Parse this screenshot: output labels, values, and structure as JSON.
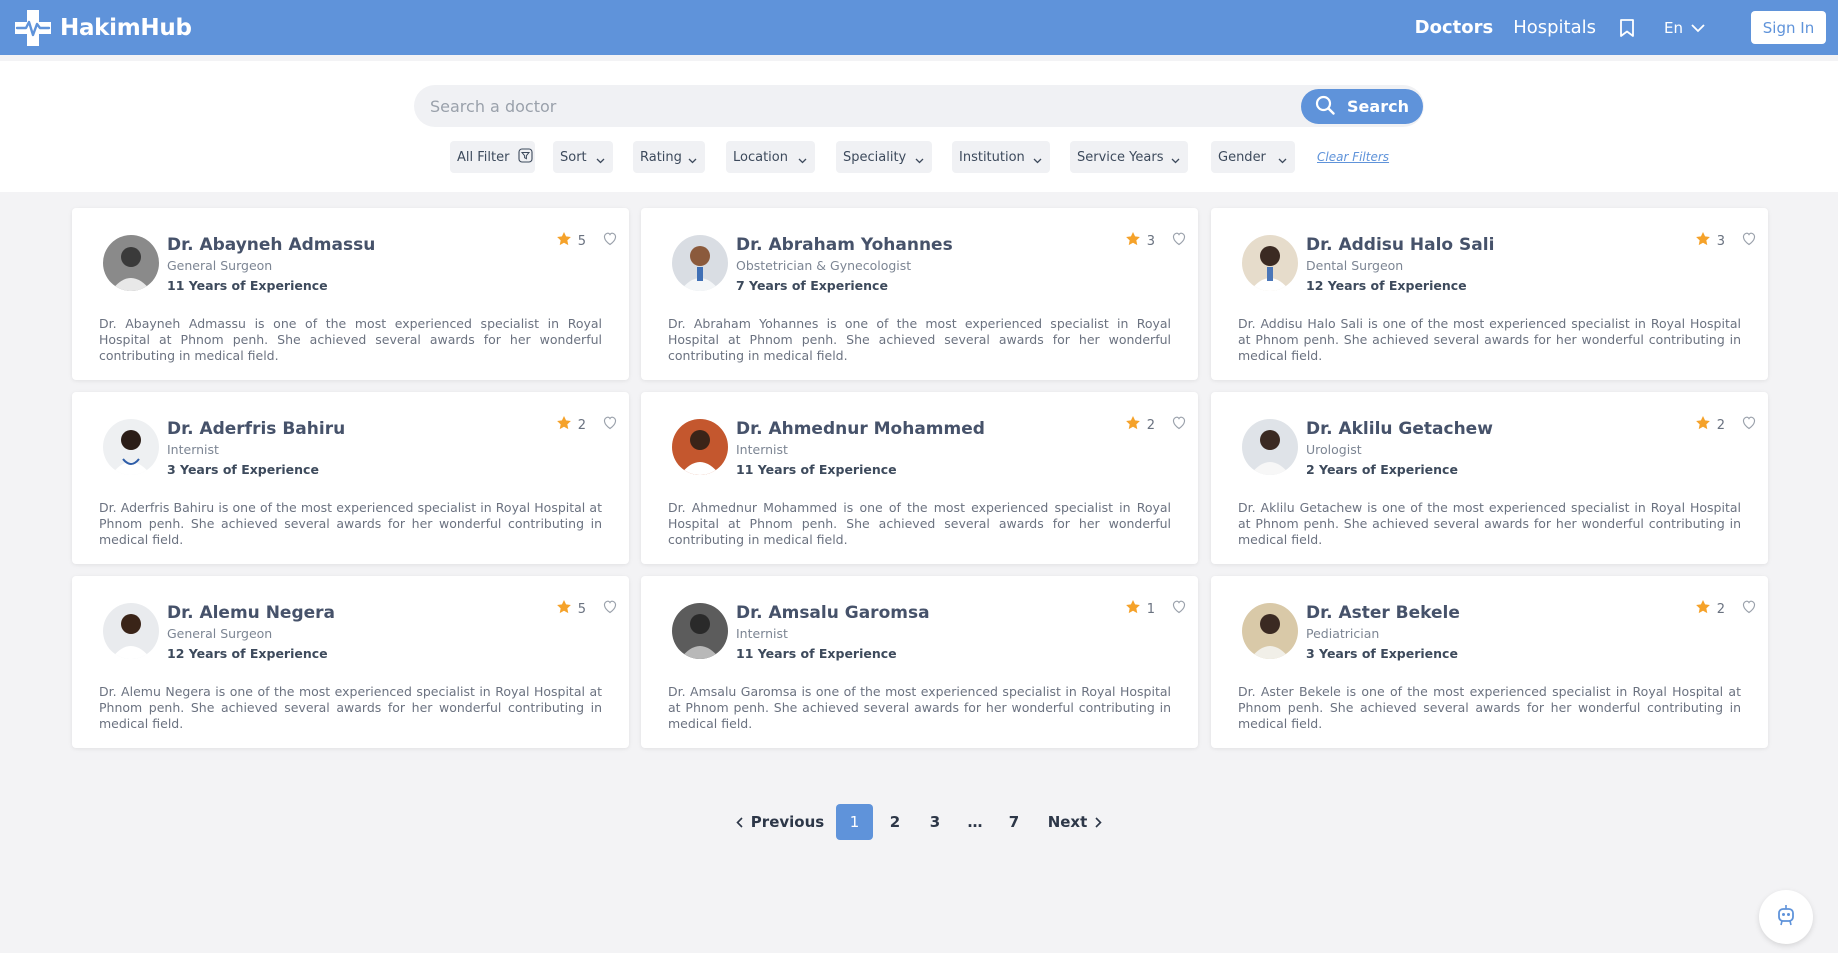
{
  "app": {
    "name": "HakimHub"
  },
  "nav": {
    "doctors": "Doctors",
    "hospitals": "Hospitals",
    "language": "En",
    "sign_in": "Sign In"
  },
  "search": {
    "placeholder": "Search a doctor",
    "value": "",
    "button": "Search"
  },
  "filters": {
    "all_filter": "All Filter",
    "sort": "Sort",
    "rating": "Rating",
    "location": "Location",
    "speciality": "Speciality",
    "institution": "Institution",
    "service_years": "Service Years",
    "gender": "Gender",
    "clear": "Clear Filters"
  },
  "doctors": [
    {
      "name": "Dr. Abayneh Admassu",
      "specialty": "General Surgeon",
      "experience": "11 Years of Experience",
      "rating": "5",
      "description": "Dr. Abayneh Admassu is one of the most experienced specialist in Royal Hospital at Phnom penh. She achieved several awards for her wonderful contributing in medical field."
    },
    {
      "name": "Dr. Abraham Yohannes",
      "specialty": "Obstetrician & Gynecologist",
      "experience": "7 Years of Experience",
      "rating": "3",
      "description": "Dr. Abraham Yohannes is one of the most experienced specialist in Royal Hospital at Phnom penh. She achieved several awards for her wonderful contributing in medical field."
    },
    {
      "name": "Dr. Addisu Halo Sali",
      "specialty": "Dental Surgeon",
      "experience": "12 Years of Experience",
      "rating": "3",
      "description": "Dr. Addisu Halo Sali is one of the most experienced specialist in Royal Hospital at Phnom penh. She achieved several awards for her wonderful contributing in medical field."
    },
    {
      "name": "Dr. Aderfris Bahiru",
      "specialty": "Internist",
      "experience": "3 Years of Experience",
      "rating": "2",
      "description": "Dr. Aderfris Bahiru is one of the most experienced specialist in Royal Hospital at Phnom penh. She achieved several awards for her wonderful contributing in medical field."
    },
    {
      "name": "Dr. Ahmednur Mohammed",
      "specialty": "Internist",
      "experience": "11 Years of Experience",
      "rating": "2",
      "description": "Dr. Ahmednur Mohammed is one of the most experienced specialist in Royal Hospital at Phnom penh. She achieved several awards for her wonderful contributing in medical field."
    },
    {
      "name": "Dr. Aklilu Getachew",
      "specialty": "Urologist",
      "experience": "2 Years of Experience",
      "rating": "2",
      "description": "Dr. Aklilu Getachew is one of the most experienced specialist in Royal Hospital at Phnom penh. She achieved several awards for her wonderful contributing in medical field."
    },
    {
      "name": "Dr. Alemu Negera",
      "specialty": "General Surgeon",
      "experience": "12 Years of Experience",
      "rating": "5",
      "description": "Dr. Alemu Negera is one of the most experienced specialist in Royal Hospital at Phnom penh. She achieved several awards for her wonderful contributing in medical field."
    },
    {
      "name": "Dr. Amsalu Garomsa",
      "specialty": "Internist",
      "experience": "11 Years of Experience",
      "rating": "1",
      "description": "Dr. Amsalu Garomsa is one of the most experienced specialist in Royal Hospital at Phnom penh. She achieved several awards for her wonderful contributing in medical field."
    },
    {
      "name": "Dr. Aster Bekele",
      "specialty": "Pediatrician",
      "experience": "3 Years of Experience",
      "rating": "2",
      "description": "Dr. Aster Bekele is one of the most experienced specialist in Royal Hospital at Phnom penh. She achieved several awards for her wonderful contributing in medical field."
    }
  ],
  "pagination": {
    "previous": "Previous",
    "next": "Next",
    "pages": [
      "1",
      "2",
      "3",
      "…",
      "7"
    ],
    "current": "1"
  },
  "colors": {
    "brand": "#5f93da",
    "star": "#f5a22a"
  },
  "icons": {
    "logo": "medical-cross-pulse-icon",
    "bookmark": "bookmark-icon",
    "search": "search-icon",
    "filter": "filter-icon",
    "chevron": "chevron-down-icon",
    "star": "star-icon",
    "favorite": "heart-icon",
    "help": "assistant-bot-icon"
  }
}
